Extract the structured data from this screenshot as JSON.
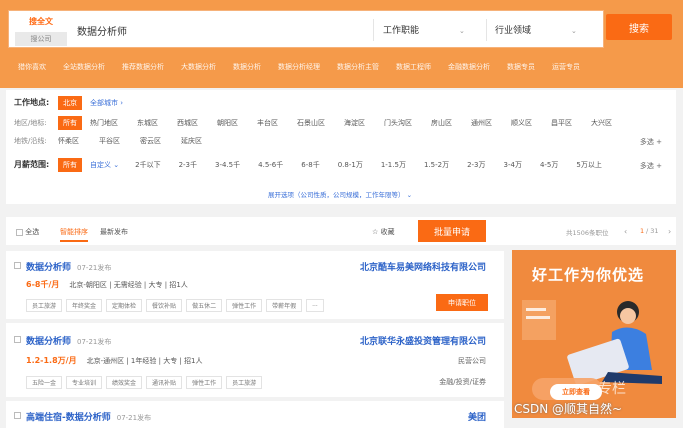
{
  "search": {
    "tab_active": "搜全文",
    "tab_inactive": "搜公司",
    "query": "数据分析师",
    "dropdown1": "工作职能",
    "dropdown2": "行业领域",
    "button": "搜索"
  },
  "categories": [
    "猎你喜欢",
    "全站数据分析",
    "推荐数据分析",
    "大数据分析",
    "数据分析",
    "数据分析经理",
    "数据分析主管",
    "数据工程师",
    "金融数据分析",
    "数据专员",
    "运营专员"
  ],
  "filters": {
    "location_label": "工作地点:",
    "location_city": "北京",
    "location_all": "全部城市",
    "district_label": "地区/地标:",
    "district_all": "所有",
    "districts_row1": [
      "热门地区",
      "东城区",
      "西城区",
      "朝阳区",
      "丰台区",
      "石景山区",
      "海淀区",
      "门头沟区",
      "房山区",
      "通州区",
      "顺义区",
      "昌平区",
      "大兴区"
    ],
    "subway_label": "地铁/沿线:",
    "districts_row2": [
      "怀柔区",
      "平谷区",
      "密云区",
      "延庆区"
    ],
    "more": "多选",
    "salary_label": "月薪范围:",
    "salary_all": "所有",
    "salary_custom": "自定义",
    "salaries": [
      "2千以下",
      "2-3千",
      "3-4.5千",
      "4.5-6千",
      "6-8千",
      "0.8-1万",
      "1-1.5万",
      "1.5-2万",
      "2-3万",
      "3-4万",
      "4-5万",
      "5万以上"
    ],
    "expand": "展开选项（公司性质，公司规模，工作年限等）"
  },
  "sortbar": {
    "select_all": "全选",
    "smart": "智能排序",
    "newest": "最新发布",
    "favorite": "收藏",
    "batch": "批量申请",
    "total": "共1506条职位",
    "prev": "‹",
    "page": "1",
    "pages": "/ 31",
    "next": "›"
  },
  "jobs": [
    {
      "title": "数据分析师",
      "date": "07-21发布",
      "company": "北京酷车易美网络科技有限公司",
      "salary": "6-8千/月",
      "meta": "北京-朝阳区 | 无需经验 | 大专 | 招1人",
      "tags": [
        "员工旅游",
        "年终奖金",
        "定期体检",
        "餐饮补贴",
        "做五休二",
        "弹性工作",
        "带薪年假",
        "..."
      ],
      "apply": "申请职位"
    },
    {
      "title": "数据分析师",
      "date": "07-21发布",
      "company": "北京联华永盛投资管理有限公司",
      "salary": "1.2-1.8万/月",
      "meta": "北京-通州区 | 1年经验 | 大专 | 招1人",
      "tags": [
        "五险一金",
        "专业培训",
        "绩效奖金",
        "通讯补贴",
        "弹性工作",
        "员工旅游"
      ],
      "comp_type": "民营公司",
      "comp_industry": "金融/投资/证券"
    },
    {
      "title": "高端住宿-数据分析师",
      "date": "07-21发布",
      "company": "美团"
    }
  ],
  "ad": {
    "title": "好工作为你优选",
    "button": "立即查看"
  },
  "watermark": "CSDN @顺其自然~",
  "watermark2": "专栏"
}
